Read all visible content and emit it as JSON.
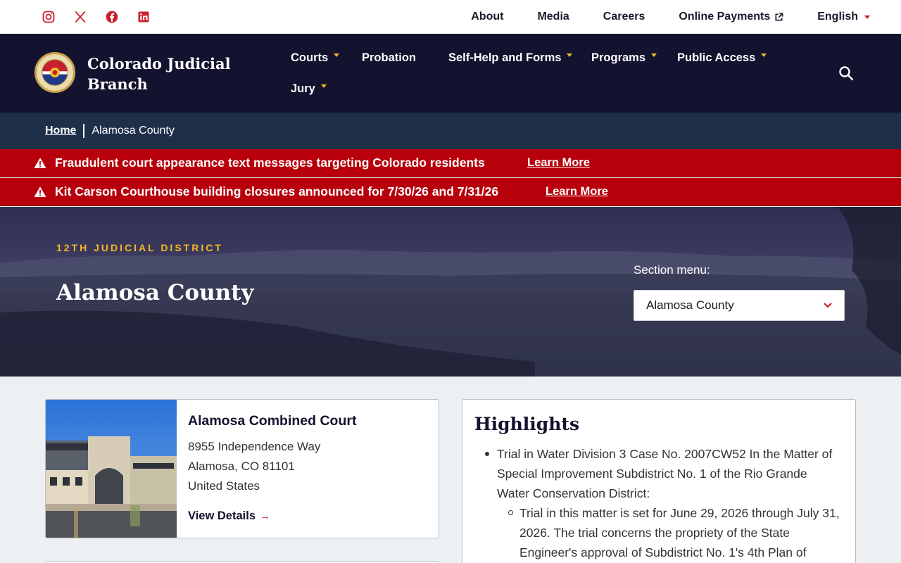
{
  "colors": {
    "brand_navy": "#13122f",
    "accent_red": "#c8202f",
    "gold": "#f4b822",
    "alert_red": "#b8000c",
    "crumb_bg": "#1d2f49"
  },
  "utility": {
    "social_icons": [
      "instagram-icon",
      "x-icon",
      "facebook-icon",
      "linkedin-icon"
    ],
    "links": [
      "About",
      "Media",
      "Careers",
      "Online Payments",
      "English"
    ]
  },
  "header": {
    "brand": "Colorado Judicial Branch",
    "nav": [
      "Courts",
      "Probation",
      "Self-Help and Forms",
      "Programs",
      "Public Access",
      "Jury"
    ],
    "search_icon": "search-icon"
  },
  "breadcrumb": {
    "home": "Home",
    "current": "Alamosa County"
  },
  "alerts": [
    {
      "text": "Fraudulent court appearance text messages targeting Colorado residents",
      "link": "Learn More"
    },
    {
      "text": "Kit Carson Courthouse building closures announced for 7/30/26 and 7/31/26",
      "link": "Learn More"
    }
  ],
  "hero": {
    "eyebrow": "12TH JUDICIAL DISTRICT",
    "title": "Alamosa County",
    "section_menu_label": "Section menu:",
    "section_menu_value": "Alamosa County"
  },
  "court_card": {
    "name": "Alamosa Combined Court",
    "address_line1": "8955 Independence Way",
    "address_line2": "Alamosa, CO 81101",
    "country": "United States",
    "link": "View Details"
  },
  "highlights": {
    "title": "Highlights",
    "item": "Trial in Water Division 3 Case No. 2007CW52 In the Matter of Special Improvement Subdistrict No. 1 of the Rio Grande Water Conservation District:",
    "sub_item": "Trial in this matter is set for June 29, 2026 through July 31, 2026. The trial concerns the propriety of the State Engineer's approval of Subdistrict No. 1's 4th Plan of"
  }
}
